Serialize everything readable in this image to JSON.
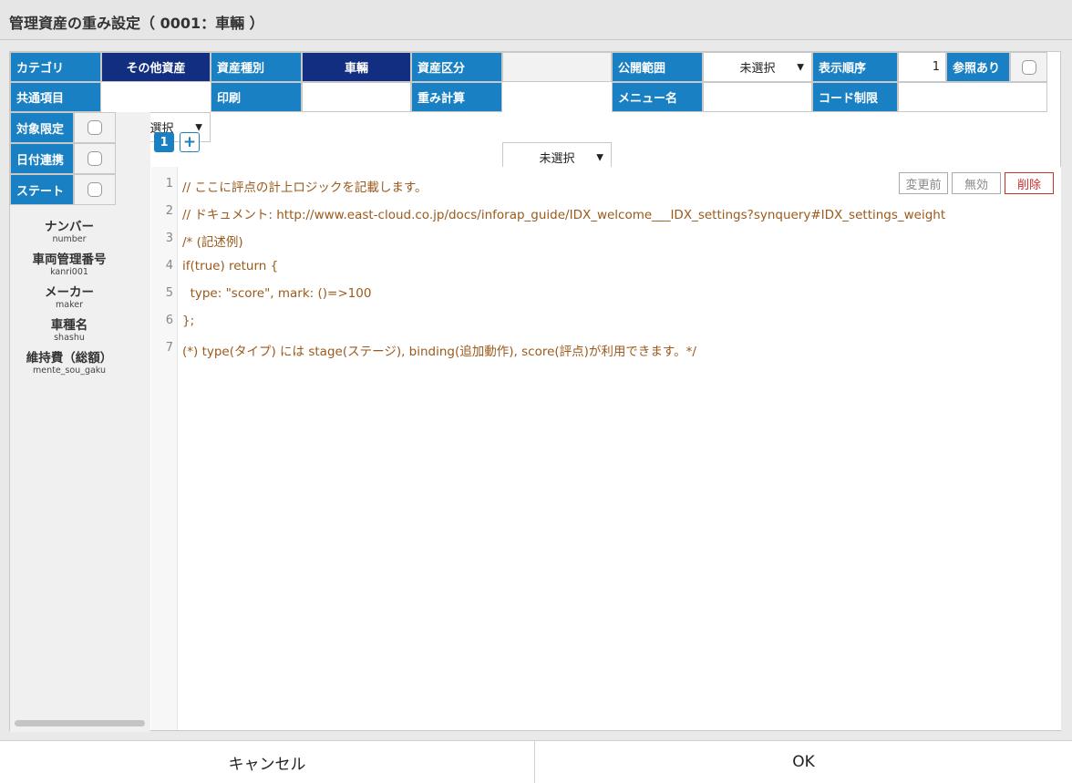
{
  "window": {
    "title": "管理資産の重み設定（ 0001：車輛 ）"
  },
  "props": {
    "category_label": "カテゴリ",
    "category_value": "その他資産",
    "asset_type_label": "資産種別",
    "asset_type_value": "車輛",
    "asset_class_label": "資産区分",
    "asset_class_value": "",
    "publish_label": "公開範囲",
    "publish_value": "未選択",
    "display_order_label": "表示順序",
    "display_order_value": "1",
    "reference_label": "参照あり",
    "common_label": "共通項目",
    "common_value": "未選択",
    "print_label": "印刷",
    "print_value": "",
    "weight_calc_label": "重み計算",
    "weight_calc_value": "未選択",
    "menu_name_label": "メニュー名",
    "menu_name_value": "",
    "code_limit_label": "コード制限",
    "code_limit_value": "",
    "target_limit_label": "対象限定",
    "date_link_label": "日付連携",
    "state_label": "ステート"
  },
  "fields": [
    {
      "jp": "ナンバー",
      "en": "number"
    },
    {
      "jp": "車両管理番号",
      "en": "kanri001"
    },
    {
      "jp": "メーカー",
      "en": "maker"
    },
    {
      "jp": "車種名",
      "en": "shashu"
    },
    {
      "jp": "維持費（総額）",
      "en": "mente_sou_gaku"
    }
  ],
  "tabs": {
    "active": "1",
    "add": "+"
  },
  "editor": {
    "line_numbers": [
      "1",
      "2",
      "3",
      "4",
      "5",
      "6",
      "7"
    ],
    "lines": [
      "// ここに評点の計上ロジックを記載します。",
      "// ドキュメント: http://www.east-cloud.co.jp/docs/inforap_guide/IDX_welcome___IDX_settings?synquery#IDX_settings_weight",
      "/* (記述例)",
      "if(true) return {",
      "  type: \"score\", mark: ()=>100",
      "};",
      "(*) type(タイプ) には stage(ステージ), binding(追加動作), score(評点)が利用できます。*/"
    ],
    "buttons": {
      "before": "変更前",
      "disable": "無効",
      "delete": "削除"
    }
  },
  "footer": {
    "cancel": "キャンセル",
    "ok": "OK"
  }
}
